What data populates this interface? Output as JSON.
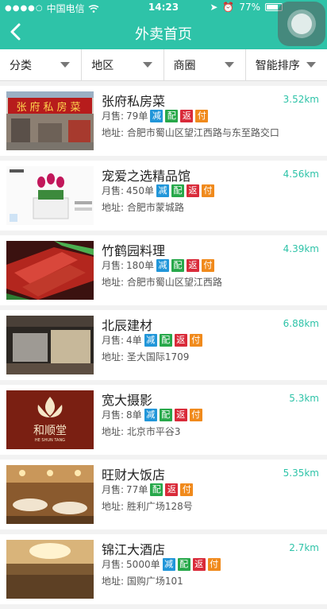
{
  "status": {
    "carrier": "中国电信",
    "time": "14:23",
    "battery": "77%"
  },
  "nav": {
    "title": "外卖首页"
  },
  "filters": [
    "分类",
    "地区",
    "商圈",
    "智能排序"
  ],
  "tags": {
    "jian": "减",
    "pei": "配",
    "fan": "返",
    "fu": "付"
  },
  "items": [
    {
      "name": "张府私房菜",
      "sales_label": "月售:",
      "sales": "79单",
      "tags": [
        "jian",
        "pei",
        "fan",
        "fu"
      ],
      "addr_label": "地址:",
      "addr": "合肥市蜀山区望江西路与东至路交口",
      "distance": "3.52km",
      "sign": "张府私房菜"
    },
    {
      "name": "宠爱之选精品馆",
      "sales_label": "月售:",
      "sales": "450单",
      "tags": [
        "jian",
        "pei",
        "fan",
        "fu"
      ],
      "addr_label": "地址:",
      "addr": "合肥市蒙城路",
      "distance": "4.56km"
    },
    {
      "name": "竹鹤园料理",
      "sales_label": "月售:",
      "sales": "180单",
      "tags": [
        "jian",
        "pei",
        "fan",
        "fu"
      ],
      "addr_label": "地址:",
      "addr": "合肥市蜀山区望江西路",
      "distance": "4.39km"
    },
    {
      "name": "北辰建材",
      "sales_label": "月售:",
      "sales": "4单",
      "tags": [
        "jian",
        "pei",
        "fan",
        "fu"
      ],
      "addr_label": "地址:",
      "addr": "圣大国际1709",
      "distance": "6.88km"
    },
    {
      "name": "宽大摄影",
      "sales_label": "月售:",
      "sales": "8单",
      "tags": [
        "jian",
        "pei",
        "fan",
        "fu"
      ],
      "addr_label": "地址:",
      "addr": "北京市平谷3",
      "distance": "5.3km",
      "logo_cn": "和顺堂",
      "logo_en": "HE SHUN TANG"
    },
    {
      "name": "旺财大饭店",
      "sales_label": "月售:",
      "sales": "77单",
      "tags": [
        "pei",
        "fan",
        "fu"
      ],
      "addr_label": "地址:",
      "addr": "胜利广场128号",
      "distance": "5.35km"
    },
    {
      "name": "锦江大酒店",
      "sales_label": "月售:",
      "sales": "5000单",
      "tags": [
        "jian",
        "pei",
        "fan",
        "fu"
      ],
      "addr_label": "地址:",
      "addr": "国购广场101",
      "distance": "2.7km"
    }
  ],
  "colors": {
    "accent": "#2ec3a8",
    "jian": "#2196d9",
    "pei": "#27a84a",
    "fan": "#d92b3a",
    "fu": "#f08a1c"
  }
}
